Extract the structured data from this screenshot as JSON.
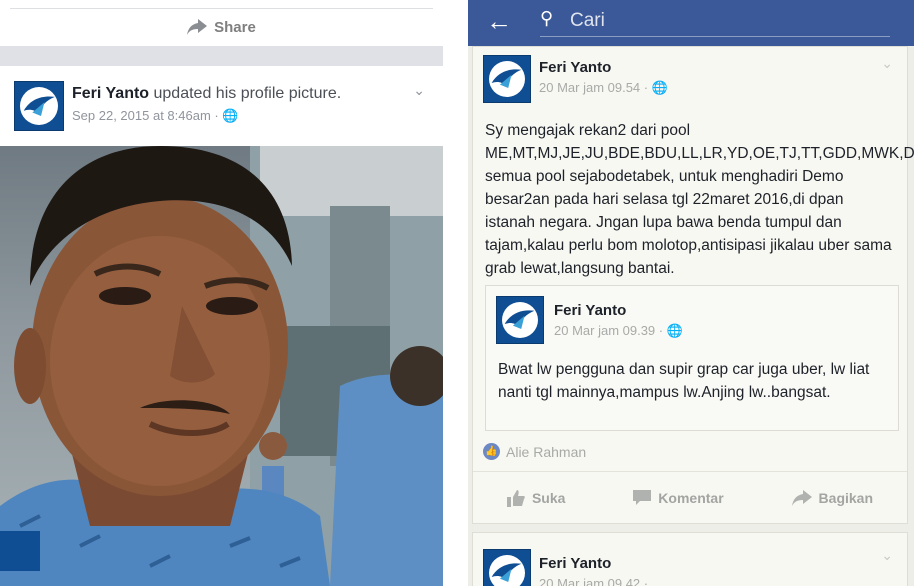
{
  "left": {
    "share_label": "Share",
    "post": {
      "author": "Feri Yanto",
      "action": " updated his profile picture.",
      "timestamp": "Sep 22, 2015 at 8:46am",
      "separator": "·"
    }
  },
  "right": {
    "search": {
      "placeholder": "Cari"
    },
    "post": {
      "author": "Feri Yanto",
      "timestamp": "20 Mar jam 09.54",
      "separator": "·",
      "body": "Sy mengajak rekan2 dari pool ME,MT,MJ,JE,JU,BDE,BDU,LL,LR,YD,OE,TJ,TT,GDD,MWK,Dan semua pool sejabodetabek, untuk menghadiri Demo besar2an pada hari selasa tgl 22maret 2016,di dpan istanah negara. Jngan lupa bawa benda tumpul dan tajam,kalau perlu bom molotop,antisipasi jikalau uber sama grab lewat,langsung bantai.",
      "shared": {
        "author": "Feri Yanto",
        "timestamp": "20 Mar jam 09.39",
        "separator": "·",
        "body": "Bwat lw pengguna dan supir grap car juga uber, lw liat nanti tgl mainnya,mampus lw.Anjing lw..bangsat."
      },
      "liked_by": "Alie Rahman",
      "actions": {
        "like": "Suka",
        "comment": "Komentar",
        "share": "Bagikan"
      }
    },
    "next_post": {
      "author": "Feri Yanto",
      "timestamp": "20 Mar jam 09.42",
      "separator": "·"
    }
  },
  "colors": {
    "facebook_blue": "#3b5998",
    "avatar_blue": "#0f4e93"
  }
}
